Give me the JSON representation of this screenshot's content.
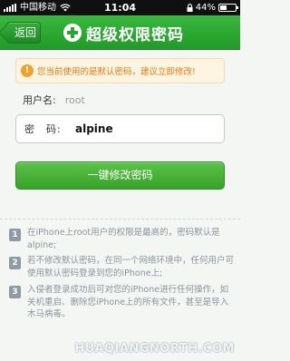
{
  "status_bar": {
    "carrier": "中国移动",
    "time": "11:04",
    "battery": "44%",
    "battery_level": 0.44
  },
  "header": {
    "back_label": "返回",
    "title": "超级权限密码"
  },
  "warning": {
    "icon": "!",
    "text": "您当前使用的是默认密码，建议立即修改!"
  },
  "user": {
    "label": "用户名:",
    "value": "root"
  },
  "password": {
    "label": "密　码:",
    "value": "alpine"
  },
  "action": {
    "label": "一键修改密码"
  },
  "notes": [
    {
      "num": "1",
      "text": "在iPhone上root用户的权限是最高的，密码默认是alpine;"
    },
    {
      "num": "2",
      "text": "若不修改默认密码，在同一个网络环境中，任何用户可使用默认密码登录到您的iPhone上;"
    },
    {
      "num": "3",
      "text": "入侵者登录成功后可对您的iPhone进行任何操作，如关机重启、删除您iPhone上的所有文件，甚至是导入木马病毒。"
    }
  ],
  "watermark": "HUAQIANGNORTH.COM",
  "colors": {
    "header_green": "#2aa531",
    "warning_orange": "#e67a14",
    "button_green": "#4cb53b"
  }
}
